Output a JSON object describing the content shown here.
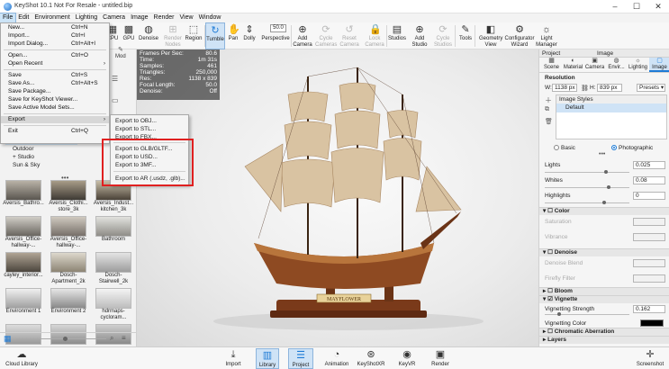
{
  "window": {
    "title": "KeyShot 10.1 Not For Resale  - untitled.bip",
    "minimize": "–",
    "maximize": "☐",
    "close": "✕"
  },
  "menubar": [
    "File",
    "Edit",
    "Environment",
    "Lighting",
    "Camera",
    "Image",
    "Render",
    "View",
    "Window",
    "Help"
  ],
  "toolbar": {
    "tools": [
      {
        "label": "CPU",
        "name": "cpu"
      },
      {
        "label": "GPU",
        "name": "gpu"
      },
      {
        "label": "Denoise",
        "name": "denoise"
      },
      {
        "label": "Render\nNodes",
        "name": "render-nodes",
        "disabled": true
      },
      {
        "label": "Region",
        "name": "region"
      },
      {
        "label": "Tumble",
        "name": "tumble",
        "selected": true
      },
      {
        "label": "Pan",
        "name": "pan"
      },
      {
        "label": "Dolly",
        "name": "dolly"
      },
      {
        "label": "Perspective",
        "name": "perspective"
      },
      {
        "label": "Add\nCamera",
        "name": "add-camera"
      },
      {
        "label": "Cycle\nCameras",
        "name": "cycle-cameras",
        "disabled": true
      },
      {
        "label": "Reset\nCamera",
        "name": "reset-camera",
        "disabled": true
      },
      {
        "label": "Lock\nCamera",
        "name": "lock-camera",
        "disabled": true
      },
      {
        "label": "Studios",
        "name": "studios"
      },
      {
        "label": "Add\nStudio",
        "name": "add-studio"
      },
      {
        "label": "Cycle\nStudios",
        "name": "cycle-studios",
        "disabled": true
      },
      {
        "label": "Tools",
        "name": "tools"
      },
      {
        "label": "Geometry\nView",
        "name": "geometry-view"
      },
      {
        "label": "Configurator\nWizard",
        "name": "configurator-wizard"
      },
      {
        "label": "Light\nManager",
        "name": "light-manager"
      }
    ],
    "fov_value": "50.0"
  },
  "file_menu": [
    {
      "label": "New...",
      "shortcut": "Ctrl+N"
    },
    {
      "label": "Import...",
      "shortcut": "Ctrl+I"
    },
    {
      "label": "Import Dialog...",
      "shortcut": "Ctrl+Alt+I"
    },
    {
      "sep": true
    },
    {
      "label": "Open...",
      "shortcut": "Ctrl+O"
    },
    {
      "label": "Open Recent",
      "arrow": "›"
    },
    {
      "sep": true
    },
    {
      "label": "Save",
      "shortcut": "Ctrl+S"
    },
    {
      "label": "Save As...",
      "shortcut": "Ctrl+Alt+S"
    },
    {
      "label": "Save Package..."
    },
    {
      "label": "Save for KeyShot Viewer..."
    },
    {
      "label": "Save Active Model Sets..."
    },
    {
      "sep": true
    },
    {
      "label": "Export",
      "arrow": "›",
      "highlight": true
    },
    {
      "sep": true
    },
    {
      "label": "Exit",
      "shortcut": "Ctrl+Q"
    }
  ],
  "export_submenu": [
    "Export to OBJ...",
    "Export to STL...",
    "Export to FBX...",
    "Export to GLB/GLTF...",
    "Export to USD...",
    "Export to 3MF...",
    "Export to AR (.usdz, .glb)..."
  ],
  "tree": [
    {
      "label": "Interior",
      "sel": true,
      "prefix": ""
    },
    {
      "label": "Outdoor",
      "prefix": ""
    },
    {
      "label": "Studio",
      "prefix": "+ "
    },
    {
      "label": "Sun & Sky",
      "prefix": ""
    }
  ],
  "left_hidden_tab": "Mod",
  "thumbnails": [
    {
      "label": "Aversis_Bathro...",
      "c1": "#b9b2a6",
      "c2": "#5a5650"
    },
    {
      "label": "Aversis_Clothi... store_3k",
      "c1": "#a89c88",
      "c2": "#3e3a34"
    },
    {
      "label": "Aversis_Indust... kitchen_3k",
      "c1": "#c8bea8",
      "c2": "#4a4238"
    },
    {
      "label": "Aversis_Office-hallway-...",
      "c1": "#d0cdc6",
      "c2": "#6a6660"
    },
    {
      "label": "Aversis_Office-hallway-...",
      "c1": "#cfc9bf",
      "c2": "#77706a"
    },
    {
      "label": "Bathroom",
      "c1": "#e2e2de",
      "c2": "#8f8d88"
    },
    {
      "label": "cayley_interior...",
      "c1": "#b0a494",
      "c2": "#4c463e"
    },
    {
      "label": "Dosch-Apartment_2k",
      "c1": "#ddd8cc",
      "c2": "#8c8474"
    },
    {
      "label": "Dosch-Stairwell_2k",
      "c1": "#e4e4e4",
      "c2": "#9c9c9c"
    },
    {
      "label": "Environment 1",
      "c1": "#f0f0f0",
      "c2": "#a0a0a0"
    },
    {
      "label": "Environment 2",
      "c1": "#e6e6e6",
      "c2": "#8a8a8a"
    },
    {
      "label": "hdrmaps-cycloram...",
      "c1": "#f4f4f4",
      "c2": "#bdbdbd"
    },
    {
      "label": "",
      "c1": "#dcdcdc",
      "c2": "#9a9a9a"
    },
    {
      "label": "",
      "c1": "#d6d6d6",
      "c2": "#8c8c8c"
    },
    {
      "label": "",
      "c1": "#cfcfcf",
      "c2": "#8a8a8a"
    }
  ],
  "stats": [
    {
      "k": "Frames Per Sec:",
      "v": "80.6"
    },
    {
      "k": "Time:",
      "v": "1m 31s"
    },
    {
      "k": "Samples:",
      "v": "461"
    },
    {
      "k": "Triangles:",
      "v": "250,000"
    },
    {
      "k": "Res:",
      "v": "1138 x 839"
    },
    {
      "k": "Focal Length:",
      "v": "50.0"
    },
    {
      "k": "Denoise:",
      "v": "Off"
    }
  ],
  "model_nameplate": "MAYFLOWER",
  "right_panel": {
    "tabs_top": [
      "Project",
      "Image"
    ],
    "tabs": [
      "Scene",
      "Material",
      "Camera",
      "Envir...",
      "Lighting",
      "Image"
    ],
    "resolution_label": "Resolution",
    "w_label": "W:",
    "w_value": "1138 px",
    "h_label": "H:",
    "h_value": "839 px",
    "presets": "Presets",
    "image_styles": "Image Styles",
    "default_style": "Default",
    "basic": "Basic",
    "photographic": "Photographic",
    "lights_label": "Lights",
    "lights_value": "0.025",
    "whites_label": "Whites",
    "whites_value": "0.08",
    "highlights_label": "Highlights",
    "highlights_value": "0",
    "color_section": "Color",
    "saturation": "Saturation",
    "vibrance": "Vibrance",
    "denoise_section": "Denoise",
    "denoise_blend": "Denoise Blend",
    "firefly_filter": "Firefly Filter",
    "bloom_section": "Bloom",
    "vignette_section": "Vignette",
    "vignette_strength_label": "Vignetting Strength",
    "vignette_strength_value": "0.162",
    "vignette_color_label": "Vignetting Color",
    "chromatic_section": "Chromatic Aberration",
    "layers_section": "Layers"
  },
  "bottom": {
    "cloud": "Cloud Library",
    "import": "Import",
    "library": "Library",
    "project": "Project",
    "animation": "Animation",
    "keyshotxr": "KeyShotXR",
    "keyvr": "KeyVR",
    "render": "Render",
    "screenshot": "Screenshot"
  },
  "colors": {
    "selection": "#cfe3f6",
    "accent": "#1e7bd6",
    "highlight_box": "#e02020"
  }
}
